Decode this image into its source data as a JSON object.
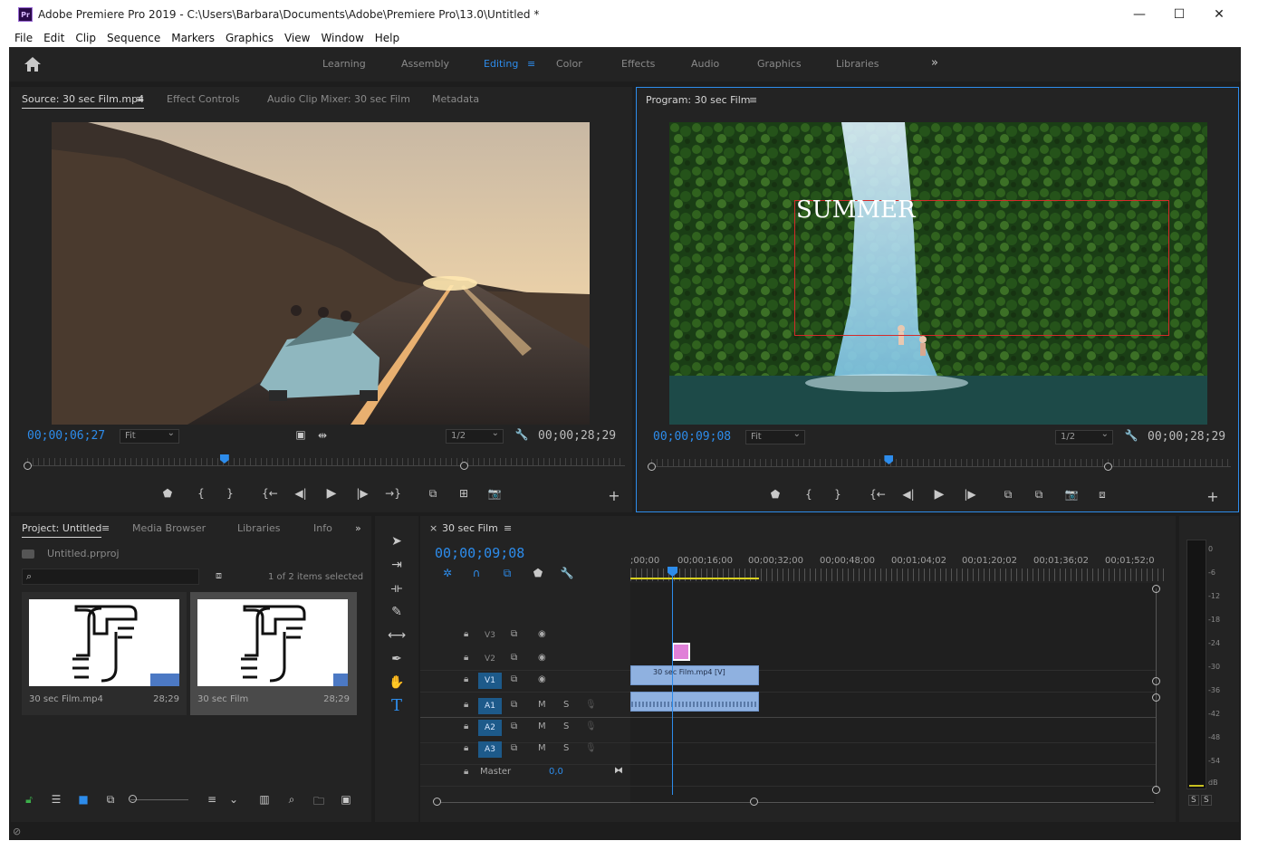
{
  "window": {
    "title": "Adobe Premiere Pro 2019 - C:\\Users\\Barbara\\Documents\\Adobe\\Premiere Pro\\13.0\\Untitled *",
    "controls": [
      "—",
      "☐",
      "✕"
    ]
  },
  "menu": [
    "File",
    "Edit",
    "Clip",
    "Sequence",
    "Markers",
    "Graphics",
    "View",
    "Window",
    "Help"
  ],
  "workspaces": {
    "tabs": [
      "Learning",
      "Assembly",
      "Editing",
      "Color",
      "Effects",
      "Audio",
      "Graphics",
      "Libraries"
    ],
    "active": "Editing",
    "more": "»"
  },
  "source_monitor": {
    "tabs": [
      "Source: 30 sec Film.mp4",
      "Effect Controls",
      "Audio Clip Mixer: 30 sec Film",
      "Metadata"
    ],
    "timecode": "00;00;06;27",
    "fit": "Fit",
    "resolution": "1/2",
    "duration": "00;00;28;29",
    "playhead_fraction": 0.33
  },
  "program_monitor": {
    "tab": "Program: 30 sec Film",
    "timecode": "00;00;09;08",
    "fit": "Fit",
    "resolution": "1/2",
    "duration": "00;00;28;29",
    "title_text": "SUMMER",
    "playhead_fraction": 0.41
  },
  "project": {
    "tabs": [
      "Project: Untitled",
      "Media Browser",
      "Libraries",
      "Info"
    ],
    "more": "»",
    "file": "Untitled.prproj",
    "search_placeholder": "",
    "selection_info": "1 of 2 items selected",
    "items": [
      {
        "name": "30 sec Film.mp4",
        "duration": "28;29"
      },
      {
        "name": "30 sec Film",
        "duration": "28;29"
      }
    ]
  },
  "timeline": {
    "tab": "30 sec Film",
    "timecode": "00;00;09;08",
    "ruler": [
      ";00;00",
      "00;00;16;00",
      "00;00;32;00",
      "00;00;48;00",
      "00;01;04;02",
      "00;01;20;02",
      "00;01;36;02",
      "00;01;52;0"
    ],
    "video_tracks": [
      "V3",
      "V2",
      "V1"
    ],
    "audio_tracks": [
      "A1",
      "A2",
      "A3"
    ],
    "master_label": "Master",
    "master_value": "0,0",
    "mute": "M",
    "solo": "S",
    "clip_name": "30 sec Film.mp4 [V]"
  },
  "audio_meter": {
    "scale": [
      "0",
      "-6",
      "-12",
      "-18",
      "-24",
      "-30",
      "-36",
      "-42",
      "-48",
      "-54",
      "dB"
    ],
    "solo_buttons": [
      "S",
      "S"
    ]
  },
  "colors": {
    "accent": "#2d8ceb",
    "panel": "#232323",
    "background": "#1d1d1d",
    "clip": "#8fb1e0",
    "title_box": "#d42a2a"
  }
}
